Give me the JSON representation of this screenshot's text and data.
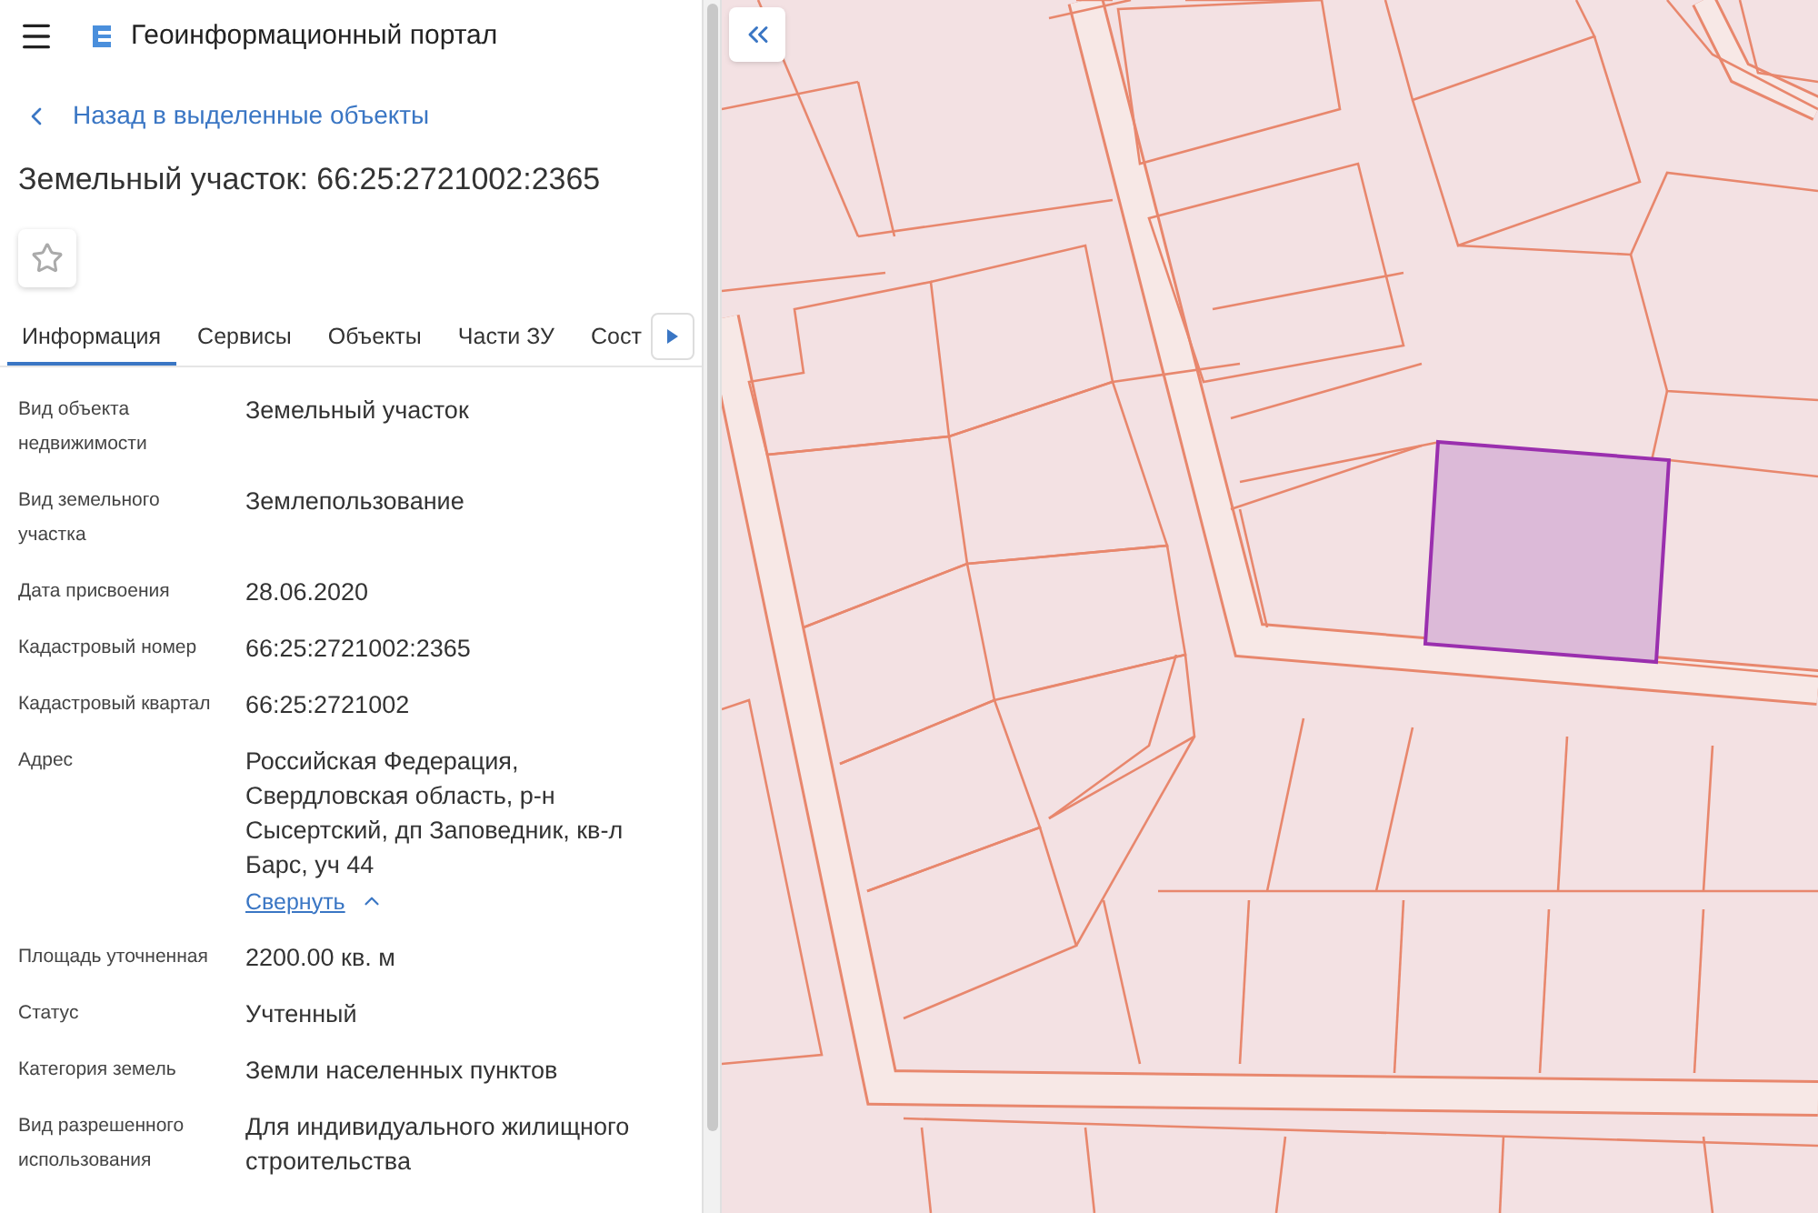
{
  "header": {
    "title": "Геоинформационный портал"
  },
  "back_link": {
    "label": "Назад в выделенные объекты"
  },
  "object_title": "Земельный участок: 66:25:2721002:2365",
  "favorite": {
    "checked": false
  },
  "tabs": [
    {
      "label": "Информация",
      "selected": true
    },
    {
      "label": "Сервисы",
      "selected": false
    },
    {
      "label": "Объекты",
      "selected": false
    },
    {
      "label": "Части ЗУ",
      "selected": false
    },
    {
      "label": "Сост",
      "selected": false
    }
  ],
  "properties": [
    {
      "label": "Вид объекта недвижимости",
      "value": "Земельный участок"
    },
    {
      "label": "Вид земельного участка",
      "value": "Землепользование"
    },
    {
      "label": "Дата присвоения",
      "value": "28.06.2020"
    },
    {
      "label": "Кадастровый номер",
      "value": "66:25:2721002:2365"
    },
    {
      "label": "Кадастровый квартал",
      "value": "66:25:2721002"
    },
    {
      "label": "Адрес",
      "value": "Российская Федерация, Свердловская область, р-н Сысертский, дп Заповедник, кв-л Барс, уч 44",
      "toggle": "Свернуть",
      "expanded": true
    },
    {
      "label": "Площадь уточненная",
      "value": "2200.00 кв. м"
    },
    {
      "label": "Статус",
      "value": "Учтенный"
    },
    {
      "label": "Категория земель",
      "value": "Земли населенных пунктов"
    },
    {
      "label": "Вид разрешенного использования",
      "value": "Для индивидуального жилищного строительства"
    }
  ]
}
